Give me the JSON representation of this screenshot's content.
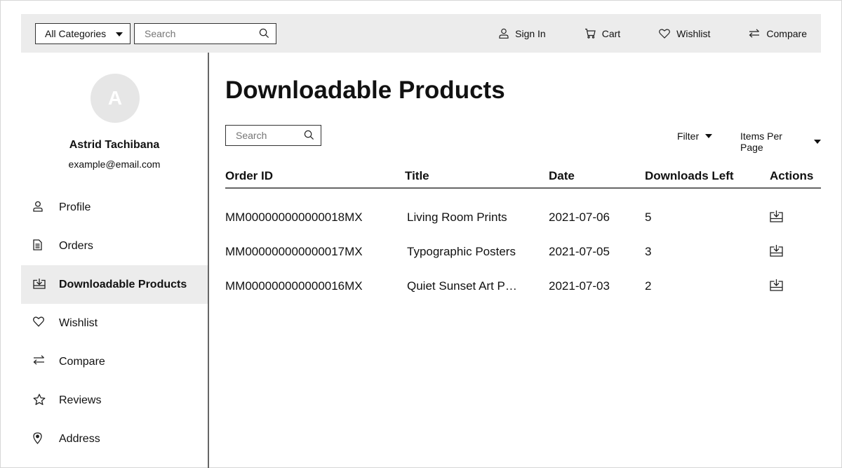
{
  "topbar": {
    "category_label": "All Categories",
    "search_placeholder": "Search",
    "links": {
      "sign_in": "Sign In",
      "cart": "Cart",
      "wishlist": "Wishlist",
      "compare": "Compare"
    }
  },
  "sidebar": {
    "avatar_letter": "A",
    "user_name": "Astrid Tachibana",
    "user_email": "example@email.com",
    "items": [
      {
        "label": "Profile",
        "icon": "user-icon"
      },
      {
        "label": "Orders",
        "icon": "document-icon"
      },
      {
        "label": "Downloadable Products",
        "icon": "download-icon",
        "active": true
      },
      {
        "label": "Wishlist",
        "icon": "heart-icon"
      },
      {
        "label": "Compare",
        "icon": "compare-arrows-icon"
      },
      {
        "label": "Reviews",
        "icon": "star-icon"
      },
      {
        "label": "Address",
        "icon": "location-pin-icon"
      }
    ]
  },
  "main": {
    "title": "Downloadable Products",
    "search_placeholder": "Search",
    "filter_label": "Filter",
    "per_page_label": "Items Per Page",
    "columns": {
      "order_id": "Order ID",
      "title": "Title",
      "date": "Date",
      "downloads_left": "Downloads Left",
      "actions": "Actions"
    },
    "rows": [
      {
        "order_id": "MM000000000000018MX",
        "title": "Living Room Prints",
        "date": "2021-07-06",
        "downloads_left": "5"
      },
      {
        "order_id": "MM000000000000017MX",
        "title": "Typographic Posters",
        "date": "2021-07-05",
        "downloads_left": "3"
      },
      {
        "order_id": "MM000000000000016MX",
        "title": "Quiet Sunset Art Print",
        "date": "2021-07-03",
        "downloads_left": "2"
      }
    ]
  }
}
